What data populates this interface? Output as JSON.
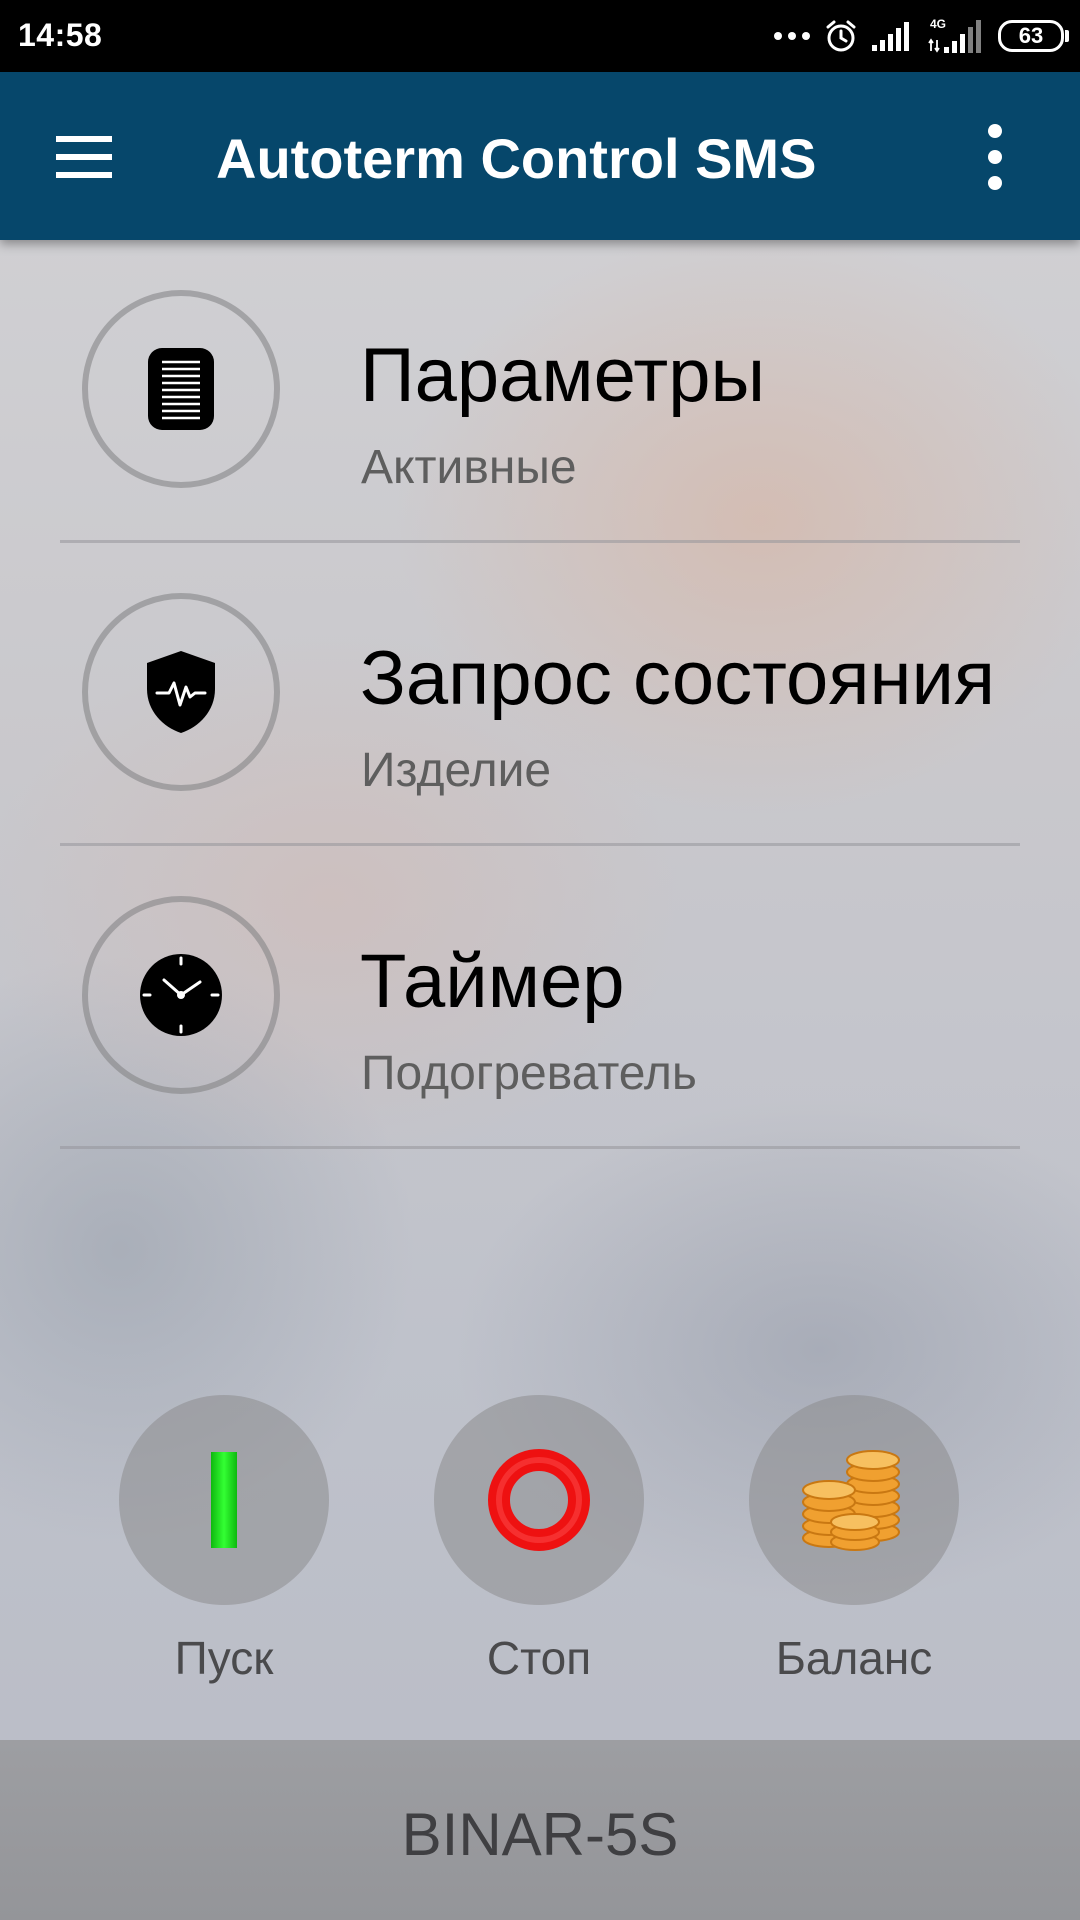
{
  "status_bar": {
    "time": "14:58",
    "network": "4G",
    "battery": "63"
  },
  "app_bar": {
    "title": "Autoterm Control SMS"
  },
  "menu_items": [
    {
      "title": "Параметры",
      "subtitle": "Активные",
      "icon": "document-icon"
    },
    {
      "title": "Запрос состояния",
      "subtitle": "Изделие",
      "icon": "shield-pulse-icon"
    },
    {
      "title": "Таймер",
      "subtitle": "Подогреватель",
      "icon": "clock-icon"
    }
  ],
  "actions": {
    "start": {
      "label": "Пуск",
      "color": "#22dd22"
    },
    "stop": {
      "label": "Стоп",
      "color": "#ee1111"
    },
    "balance": {
      "label": "Баланс",
      "color": "#f0a030"
    }
  },
  "footer": {
    "device": "BINAR-5S"
  },
  "colors": {
    "app_bar": "#06476b",
    "status_bar": "#000000"
  }
}
